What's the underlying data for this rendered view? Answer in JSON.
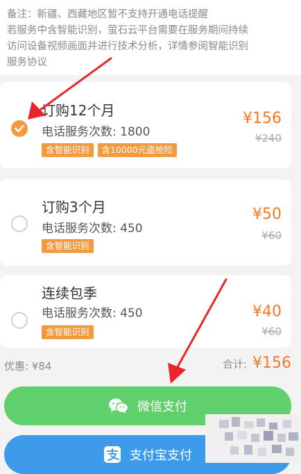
{
  "notice": {
    "lines": [
      "备注：新疆、西藏地区暂不支持开通电话提醒",
      "若服务中含智能识别，萤石云平台需要在服务期间持续",
      "访问设备视频画面并进行技术分析，详情参阅智能识别",
      "服务协议"
    ]
  },
  "plans": [
    {
      "title": "订购12个月",
      "calls": "电话服务次数: 1800",
      "tags": [
        "含智能识别",
        "含10000元盗抢险"
      ],
      "price": "¥156",
      "original_price": "¥240",
      "selected": true
    },
    {
      "title": "订购3个月",
      "calls": "电话服务次数: 450",
      "tags": [
        "含智能识别"
      ],
      "price": "¥50",
      "original_price": "¥60",
      "selected": false
    },
    {
      "title": "连续包季",
      "calls": "电话服务次数: 450",
      "tags": [
        "含智能识别"
      ],
      "price": "¥40",
      "original_price": "¥60",
      "selected": false
    }
  ],
  "summary": {
    "discount": "优惠: ¥84",
    "total_label": "合计:",
    "total_value": "¥156"
  },
  "payment": {
    "wechat_label": "微信支付",
    "alipay_label": "支付宝支付"
  },
  "colors": {
    "accent_orange": "#f39a3e",
    "price_orange": "#f07a28",
    "wechat_green": "#5fd06b",
    "alipay_blue": "#3d9be9",
    "annotation_red": "#e8262b"
  }
}
